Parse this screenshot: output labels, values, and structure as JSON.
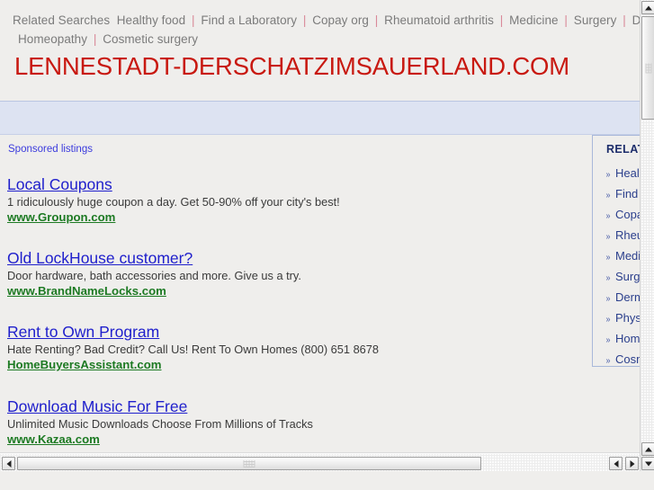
{
  "topnav": {
    "lead_label": "Related Searches",
    "separator": "|",
    "items": [
      "Healthy food",
      "Find a Laboratory",
      "Copay org",
      "Rheumatoid arthritis",
      "Medicine",
      "Surgery",
      "Dermato",
      "Homeopathy",
      "Cosmetic surgery"
    ]
  },
  "domain_title": "LENNESTADT-DERSCHATZIMSAUERLAND.COM",
  "sponsored": {
    "label": "Sponsored listings",
    "ads": [
      {
        "title": "Local Coupons",
        "description": "1 ridiculously huge coupon a day. Get 50-90% off your city's best!",
        "url": "www.Groupon.com"
      },
      {
        "title": "Old LockHouse customer?",
        "description": "Door hardware, bath accessories and more. Give us a try.",
        "url": "www.BrandNameLocks.com"
      },
      {
        "title": "Rent to Own Program",
        "description": "Hate Renting? Bad Credit? Call Us! Rent To Own Homes (800) 651 8678",
        "url": "HomeBuyersAssistant.com"
      },
      {
        "title": "Download Music For Free",
        "description": "Unlimited Music Downloads Choose From Millions of Tracks",
        "url": "www.Kazaa.com"
      }
    ]
  },
  "related_box": {
    "heading": "RELATED SEARCHES",
    "bullet": "»",
    "items": [
      "Healthy food",
      "Find a Laboratory",
      "Copay org",
      "Rheumatoid arthritis",
      "Medicine",
      "Surgery",
      "Dermatology",
      "Physician",
      "Homeopathy",
      "Cosmetic surgery"
    ]
  },
  "colors": {
    "page_background": "#efeeec",
    "domain_title": "#c81911",
    "lavender_band": "#dde3f2",
    "ad_title_link": "#2020cc",
    "ad_url_link": "#1d7a23",
    "nav_text": "#7b7b7b",
    "nav_separator": "#d98a99",
    "related_heading": "#1d2d6b",
    "related_item": "#2b3f8c",
    "sponsored_label": "#3b3bdd"
  },
  "scrollbars": {
    "vertical_up_icon": "arrow-up-icon",
    "vertical_down_icon": "arrow-down-icon",
    "horizontal_left_icon": "arrow-left-icon",
    "horizontal_right_icon": "arrow-right-icon"
  }
}
